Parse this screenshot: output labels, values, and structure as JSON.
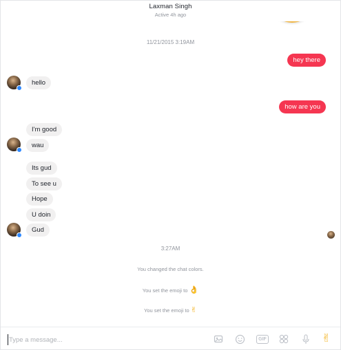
{
  "header": {
    "contact_name": "Laxman Singh",
    "status": "Active 4h ago"
  },
  "thread": {
    "timestamp_1": "11/21/2015 3:19AM",
    "timestamp_2": "3:27AM",
    "outgoing": [
      "hey there",
      "how are you"
    ],
    "incoming_1": [
      "hello"
    ],
    "incoming_2": [
      "I'm good",
      "wau"
    ],
    "incoming_3": [
      "Its gud",
      "To see u",
      "Hope",
      "U doin",
      "Gud"
    ],
    "system_messages": [
      "You changed the chat colors.",
      "You set the emoji to",
      "You set the emoji to"
    ],
    "system_emoji": [
      "👌",
      "✌"
    ]
  },
  "composer": {
    "placeholder": "Type a message...",
    "icons": [
      "photo-icon",
      "emoji-icon",
      "gif-icon",
      "sticker-icon",
      "microphone-icon",
      "thumbs-emoji-icon"
    ],
    "gif_label": "GIF",
    "send_emoji": "✌"
  },
  "colors": {
    "accent": "#f53651",
    "incoming_bubble": "#f1f0f0",
    "badge": "#2d88ff"
  }
}
